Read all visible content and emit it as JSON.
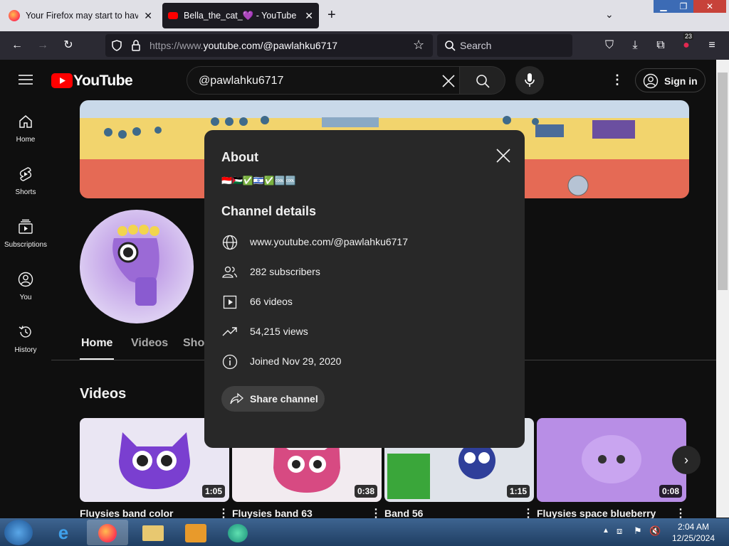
{
  "browser": {
    "tabs": [
      {
        "label": "Your Firefox may start to have p",
        "active": false
      },
      {
        "label": "Bella_the_cat_💜 - YouTube",
        "active": true
      }
    ],
    "url_prefix": "https://www.",
    "url_main": "youtube.com/@pawlahku6717",
    "search_placeholder": "Search",
    "extension_badge": "23"
  },
  "youtube": {
    "logo_text": "YouTube",
    "search_value": "@pawlahku6717",
    "sign_in_label": "Sign in",
    "sidebar": [
      {
        "label": "Home",
        "icon": "home-icon"
      },
      {
        "label": "Shorts",
        "icon": "shorts-icon"
      },
      {
        "label": "Subscriptions",
        "icon": "subscriptions-icon"
      },
      {
        "label": "You",
        "icon": "you-icon"
      },
      {
        "label": "History",
        "icon": "history-icon"
      }
    ],
    "channel_tabs": [
      "Home",
      "Videos",
      "Shor"
    ],
    "section_title": "Videos",
    "videos": [
      {
        "title": "Fluysies band color",
        "duration": "1:05",
        "color": "#e9e4f2"
      },
      {
        "title": "Fluysies band 63",
        "duration": "0:38",
        "color": "#f0e8ee"
      },
      {
        "title": "Band 56",
        "duration": "1:15",
        "color": "#dfe3ea"
      },
      {
        "title": "Fluysies space blueberry",
        "duration": "0:08",
        "color": "#b88ee6"
      }
    ]
  },
  "about": {
    "title": "About",
    "description": "🇮🇩🇵🇸✅🇮🇱✅🆒🆒",
    "channel_details_heading": "Channel details",
    "url": "www.youtube.com/@pawlahku6717",
    "subscribers": "282 subscribers",
    "videos": "66 videos",
    "views": "54,215 views",
    "joined": "Joined Nov 29, 2020",
    "share_label": "Share channel"
  },
  "taskbar": {
    "time": "2:04 AM",
    "date": "12/25/2024"
  },
  "colors": {
    "yt_red": "#ff0000",
    "modal_bg": "#282828",
    "page_bg": "#0f0f0f"
  }
}
